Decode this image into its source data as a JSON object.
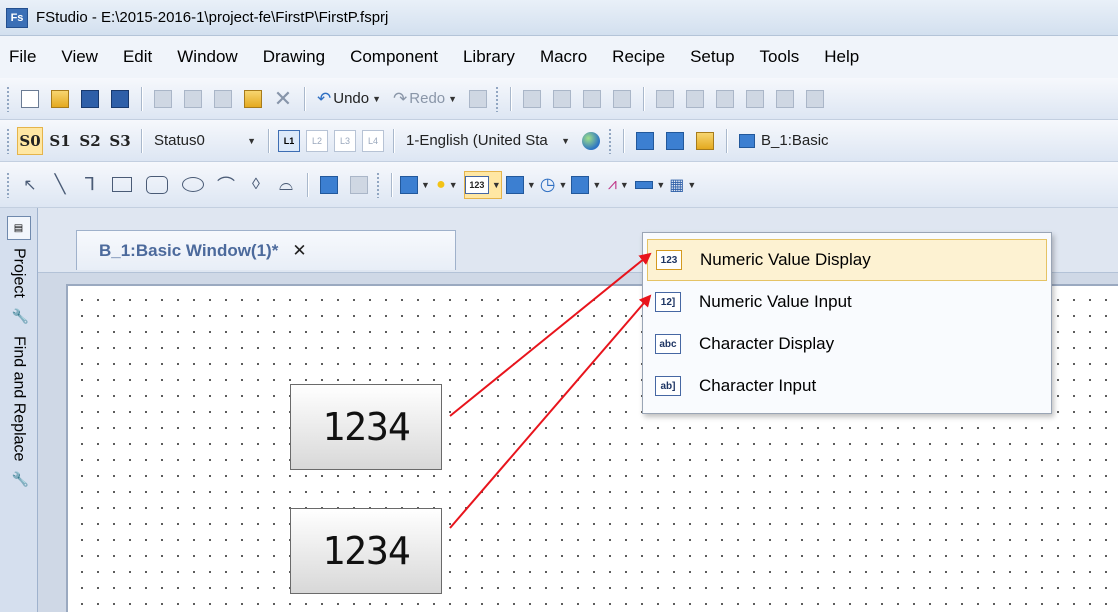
{
  "window": {
    "app_icon_text": "Fs",
    "title": "FStudio - E:\\2015-2016-1\\project-fe\\FirstP\\FirstP.fsprj"
  },
  "menu": [
    "File",
    "View",
    "Edit",
    "Window",
    "Drawing",
    "Component",
    "Library",
    "Macro",
    "Recipe",
    "Setup",
    "Tools",
    "Help"
  ],
  "toolbar1": {
    "undo_label": "Undo",
    "redo_label": "Redo"
  },
  "toolbar2": {
    "state_buttons": [
      "S0",
      "S1",
      "S2",
      "S3"
    ],
    "status_value": "Status0",
    "layer_buttons": [
      "L1",
      "L2",
      "L3",
      "L4"
    ],
    "language_value": "1-English (United Sta",
    "window_selector": "B_1:Basic"
  },
  "toolbar3": {
    "numeric_button_text": "123"
  },
  "side_panel": {
    "tabs": [
      "Project",
      "Find and Replace"
    ]
  },
  "document": {
    "tab_label": "B_1:Basic Window(1)*",
    "close_glyph": "✕"
  },
  "canvas": {
    "numeric_display_1": "1234",
    "numeric_display_2": "1234"
  },
  "dropdown": {
    "items": [
      {
        "icon_text": "123",
        "label": "Numeric Value Display"
      },
      {
        "icon_text": "12]",
        "label": "Numeric Value Input"
      },
      {
        "icon_text": "abc",
        "label": "Character Display"
      },
      {
        "icon_text": "ab]",
        "label": "Character Input"
      }
    ]
  },
  "colors": {
    "arrow": "#e8141c",
    "hover_fill": "#fdf2d2",
    "tab_text": "#4c6a9c"
  }
}
